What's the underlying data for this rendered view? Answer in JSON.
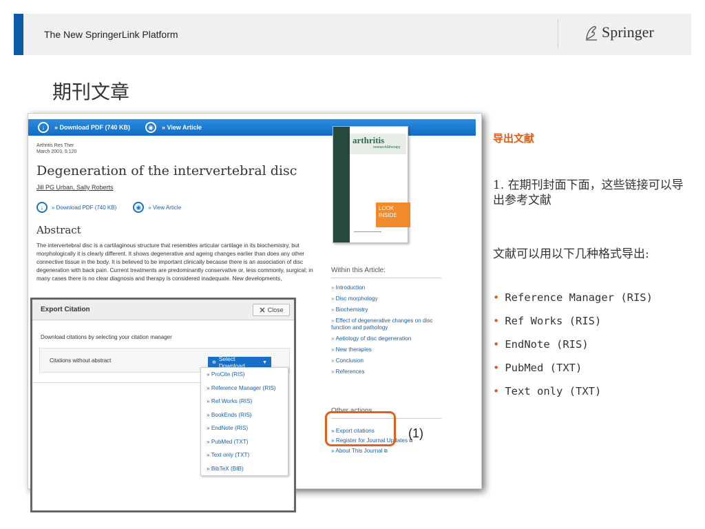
{
  "header": {
    "title": "The New SpringerLink Platform",
    "logo_text": "Springer"
  },
  "slide_title": "期刊文章",
  "article": {
    "topbar": {
      "download_pdf": "» Download PDF (740 KB)",
      "view_article": "» View Article"
    },
    "meta_line1": "Arthritis Res Ther",
    "meta_line2": "March 2003, 5:120",
    "title": "Degeneration of the intervertebral disc",
    "authors": "Jill PG Urban, Sally Roberts",
    "download_pdf": "» Download PDF (740 KB)",
    "view_article": "» View Article",
    "abstract_heading": "Abstract",
    "abstract_text": "The intervertebral disc is a cartilaginous structure that resembles articular cartilage in its biochemistry, but morphologically it is clearly different. It shows degenerative and ageing changes earlier than does any other connective tissue in the body. It is believed to be important clinically because there is an association of disc degeneration with back pain. Current treatments are predominantly conservative or, less commonly, surgical; in many cases there is no clear diagnosis and therapy is considered inadequate. New developments,",
    "cover": {
      "title": "arthritis",
      "subtitle": "research&therapy",
      "look_inside": "LOOK INSIDE"
    },
    "within_heading": "Within this Article:",
    "toc": [
      "Introduction",
      "Disc morphology",
      "Biochemistry",
      "Effect of degenerative changes on disc function and pathology",
      "Aetiology of disc degeneration",
      "New therapies",
      "Conclusion",
      "References"
    ],
    "other_heading": "Other actions",
    "actions": [
      "Export citations",
      "Register for Journal Updates",
      "About This Journal"
    ]
  },
  "callout_label": "(1)",
  "dialog": {
    "title": "Export Citation",
    "close_label": "Close",
    "description": "Download citations by selecting your citation manager",
    "row_label": "Citations without abstract",
    "select_label": "Select Download",
    "options": [
      "» ProCite (RIS)",
      "» Reference Manager (RIS)",
      "» Ref Works (RIS)",
      "» BookEnds (RIS)",
      "» EndNote (RIS)",
      "» PubMed (TXT)",
      "» Text only (TXT)",
      "» BibTeX (BIB)"
    ]
  },
  "right_panel": {
    "heading": "导出文献",
    "para1": "1. 在期刊封面下面，这些链接可以导出参考文献",
    "para2": "文献可以用以下几种格式导出:",
    "formats": [
      "Reference Manager (RIS)",
      "Ref Works (RIS)",
      "EndNote (RIS)",
      "PubMed (TXT)",
      "Text only (TXT)"
    ]
  },
  "colors": {
    "accent_blue": "#0b5aa8",
    "link_blue": "#1a5fa8",
    "highlight_orange": "#e0601c"
  }
}
